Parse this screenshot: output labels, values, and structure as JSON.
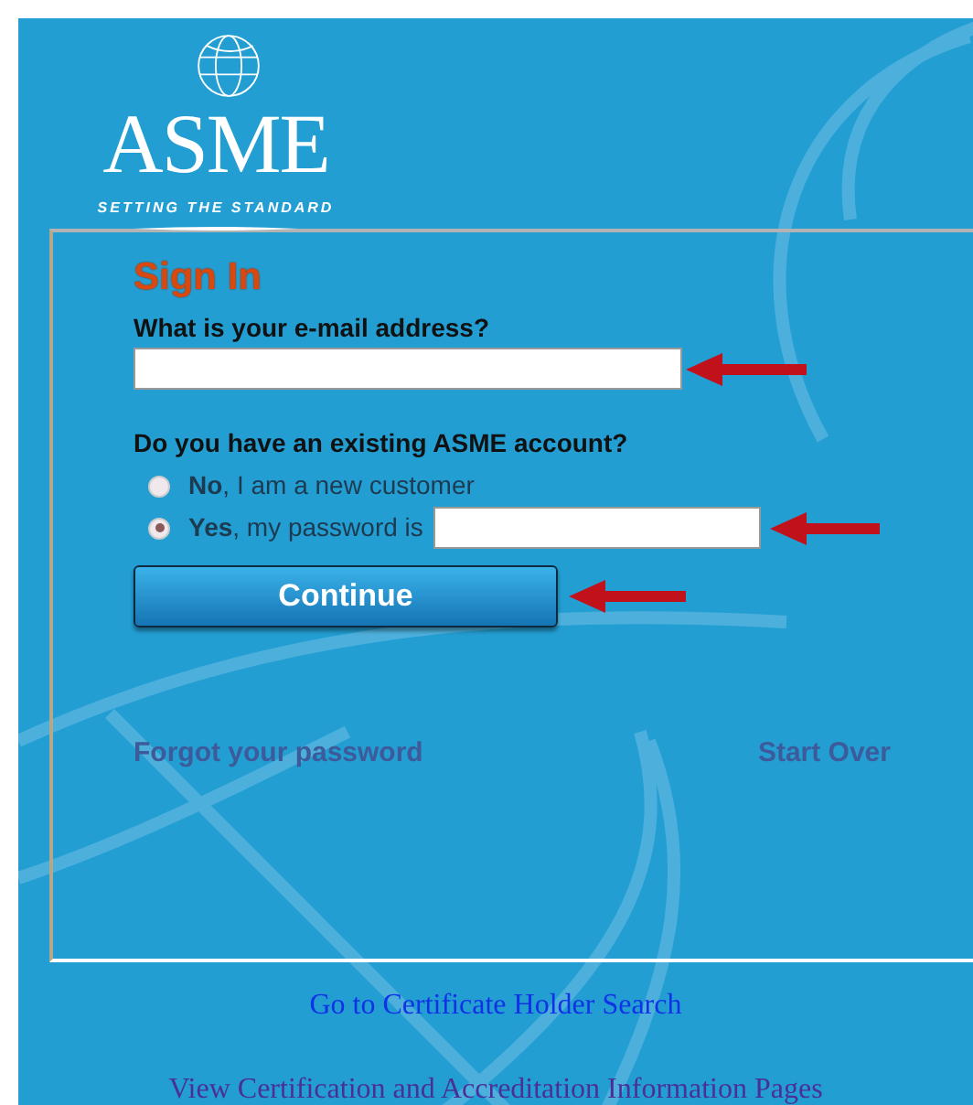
{
  "logo": {
    "name": "ASME",
    "tagline": "SETTING THE STANDARD"
  },
  "form": {
    "title": "Sign In",
    "email_label": "What is your e-mail address?",
    "account_question": "Do you have an existing ASME account?",
    "options": [
      {
        "kind": "plain",
        "label": "**No**, I am a new customer",
        "selected": false
      },
      {
        "kind": "password",
        "label": "**Yes**, my password is",
        "selected": true
      }
    ],
    "button": "Continue",
    "links": [
      "Forgot your password",
      "Start Over"
    ]
  },
  "footer_links": [
    {
      "label": "Go to Certificate Holder Search",
      "visited": false
    },
    {
      "label": "View Certification and Accreditation Information Pages",
      "visited": true
    }
  ]
}
